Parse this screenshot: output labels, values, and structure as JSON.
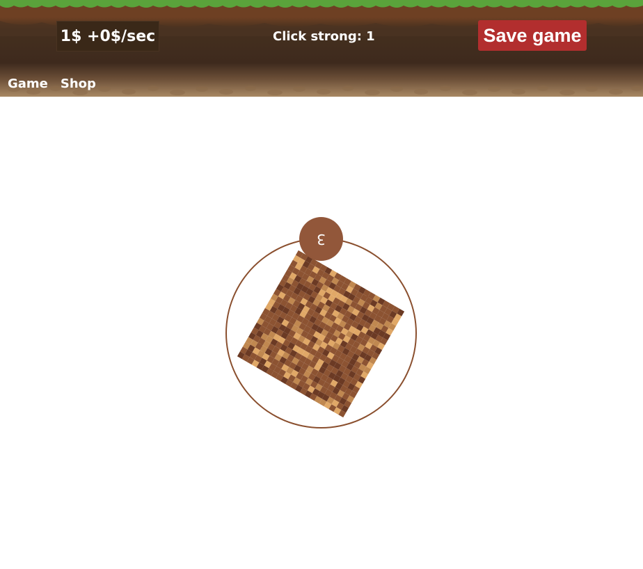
{
  "header": {
    "money": "1$ +0$/sec",
    "click_strong": "Click strong: 1",
    "save_button": "Save game"
  },
  "nav": {
    "items": [
      {
        "label": "Game"
      },
      {
        "label": "Shop"
      }
    ]
  },
  "game": {
    "counter": "3"
  },
  "colors": {
    "grass": "#6cb84a",
    "soil": "#6e4023",
    "dirt_dark": "#3e2a1d",
    "save_button": "#b22e2e",
    "ring": "#8a4f2e",
    "block_dark": "#6b3a24",
    "block_mid": "#8c5332",
    "block_light": "#c08850",
    "block_highlight": "#e0a867"
  }
}
